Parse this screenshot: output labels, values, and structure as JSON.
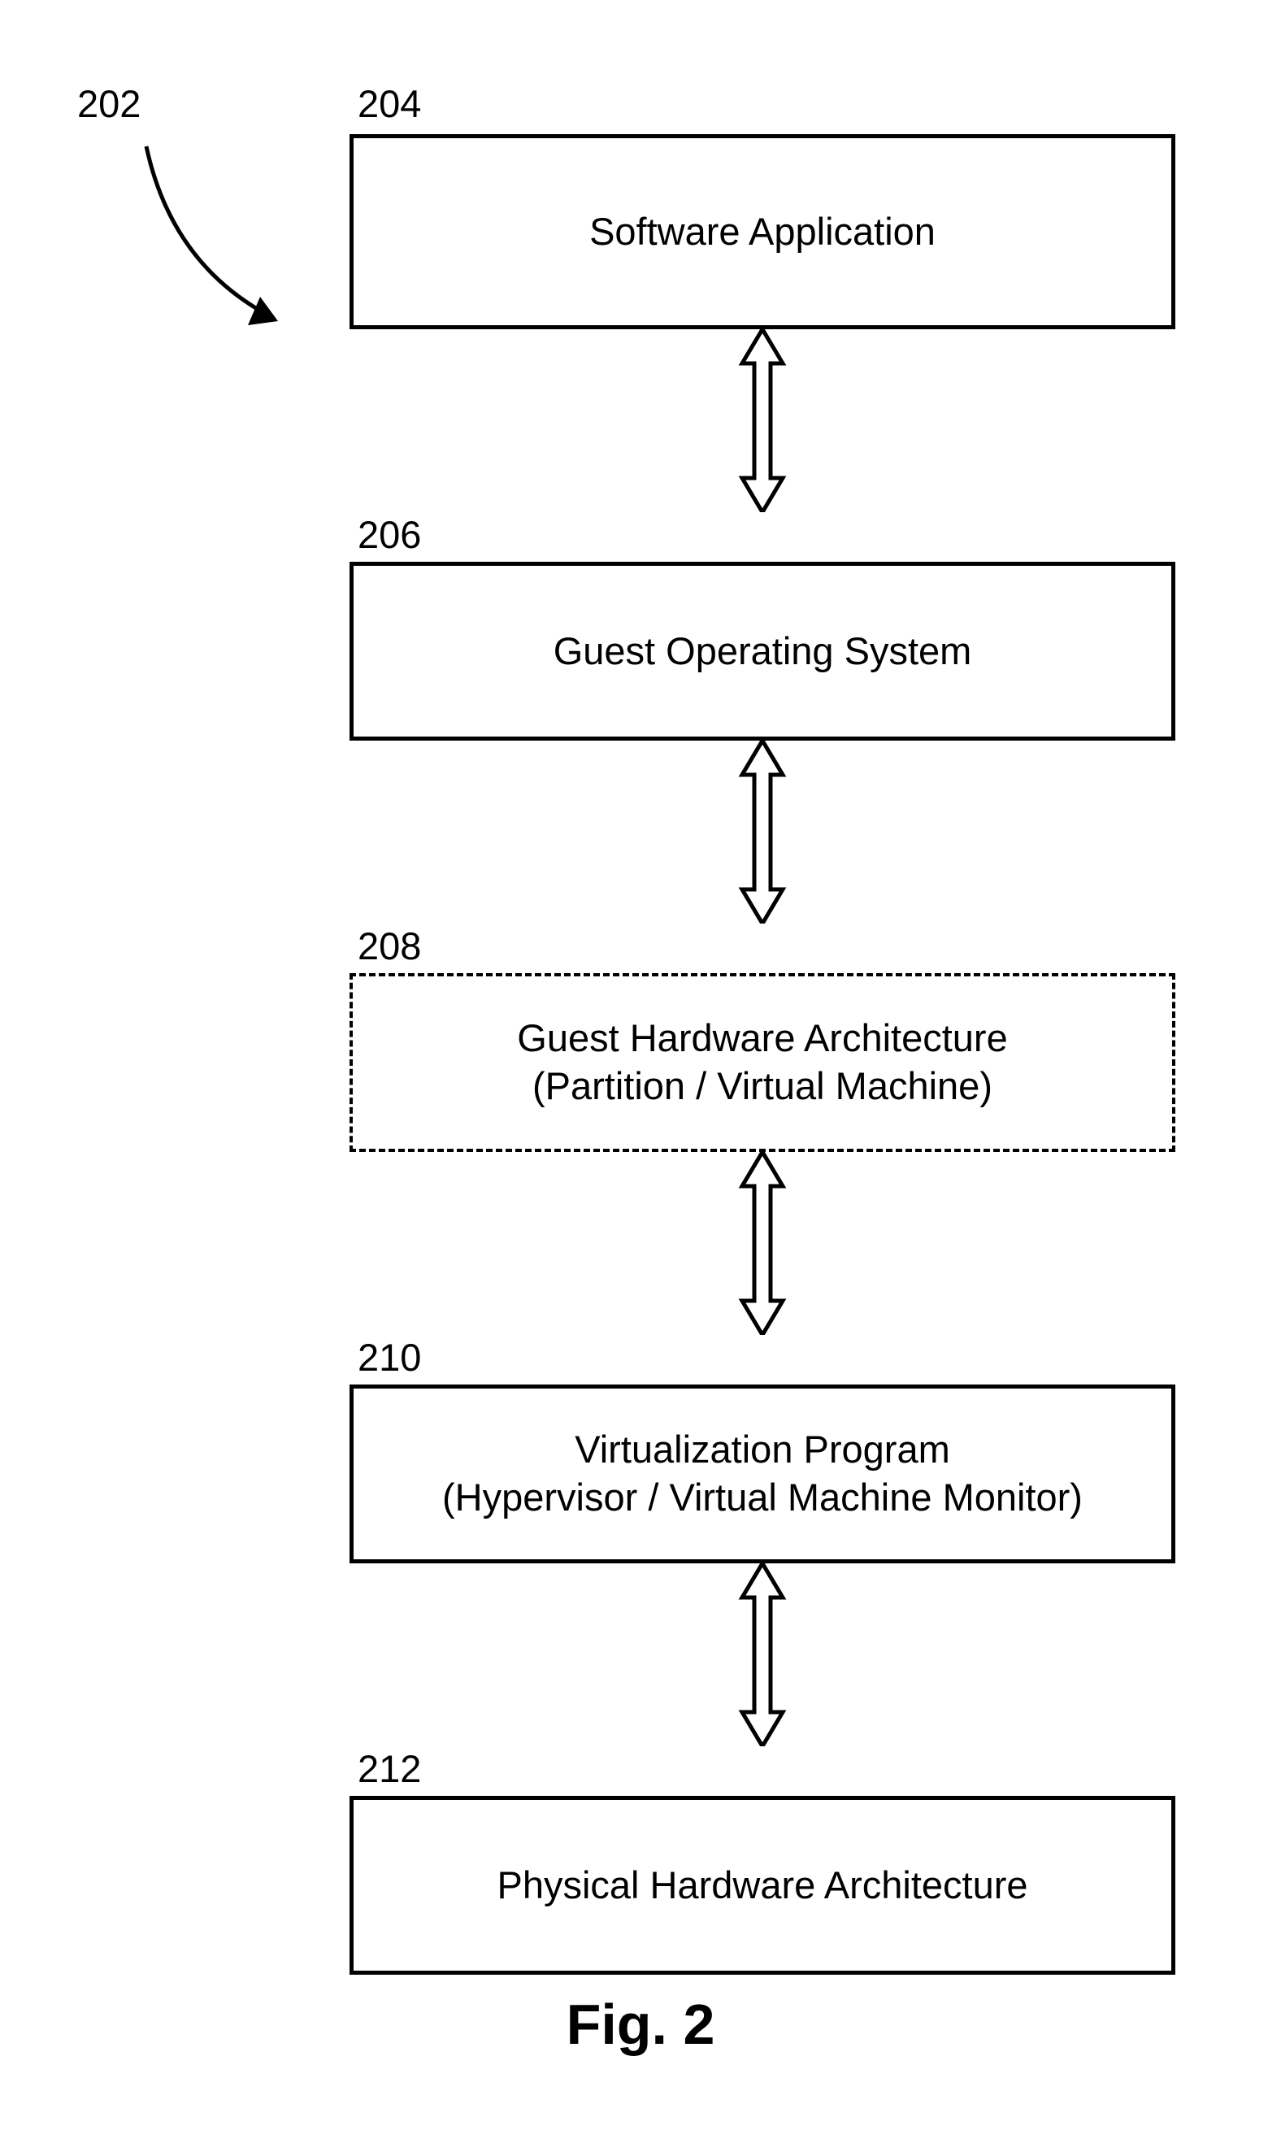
{
  "refs": {
    "top": "202",
    "b1": "204",
    "b2": "206",
    "b3": "208",
    "b4": "210",
    "b5": "212"
  },
  "boxes": {
    "b1_l1": "Software Application",
    "b2_l1": "Guest Operating System",
    "b3_l1": "Guest Hardware Architecture",
    "b3_l2": "(Partition / Virtual Machine)",
    "b4_l1": "Virtualization Program",
    "b4_l2": "(Hypervisor / Virtual Machine Monitor)",
    "b5_l1": "Physical Hardware Architecture"
  },
  "caption": "Fig. 2"
}
